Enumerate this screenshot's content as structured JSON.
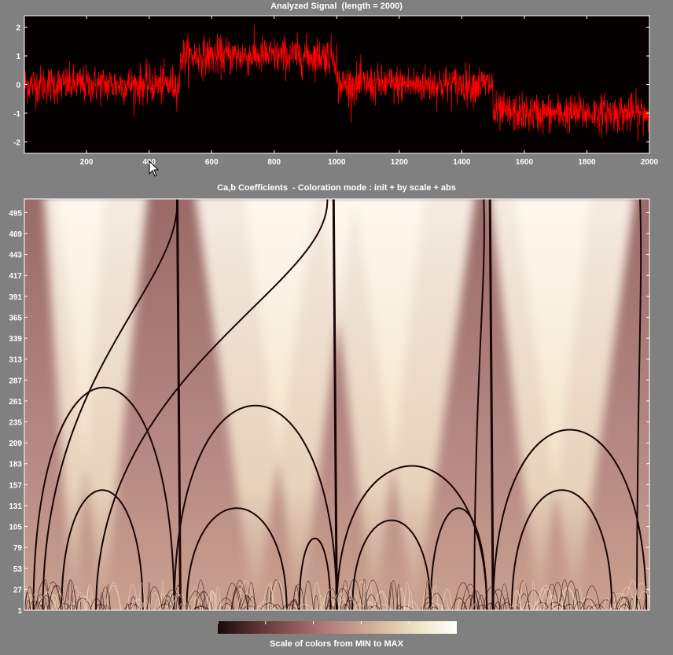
{
  "colors": {
    "background": "#808080",
    "plot_background": "#050000",
    "signal": "#ff0000",
    "text": "#ffffff",
    "colormap": [
      "#1a0a0a",
      "#6a3a3a",
      "#b07a78",
      "#d9b89c",
      "#f0e6c8",
      "#ffffff"
    ]
  },
  "cursor_icon": "arrow-pointer-icon",
  "chart_data": [
    {
      "type": "line",
      "title": "Analyzed Signal  (length = 2000)",
      "xlim": [
        1,
        2000
      ],
      "ylim": [
        -2.4,
        2.4
      ],
      "xticks": [
        200,
        400,
        600,
        800,
        1000,
        1200,
        1400,
        1600,
        1800,
        2000
      ],
      "yticks": [
        -2,
        -1,
        0,
        1,
        2
      ],
      "grid": false,
      "series": [
        {
          "segments": [
            {
              "x": [
                1,
                500
              ],
              "mean": 0.0
            },
            {
              "x": [
                500,
                1000
              ],
              "mean": 1.0
            },
            {
              "x": [
                1000,
                1500
              ],
              "mean": 0.0
            },
            {
              "x": [
                1500,
                2000
              ],
              "mean": -1.0
            }
          ],
          "noise_amplitude": 0.6
        }
      ]
    },
    {
      "type": "heatmap",
      "title": "Ca,b Coefficients  - Coloration mode : init + by scale + abs",
      "xlim": [
        1,
        2000
      ],
      "ylim": [
        1,
        512
      ],
      "yticks": [
        1,
        27,
        53,
        79,
        105,
        131,
        157,
        183,
        209,
        235,
        261,
        287,
        313,
        339,
        365,
        391,
        417,
        443,
        469,
        495
      ],
      "breakpoints": [
        500,
        1000,
        1500
      ]
    }
  ],
  "colorbar": {
    "label": "Scale of colors from MIN to MAX"
  }
}
